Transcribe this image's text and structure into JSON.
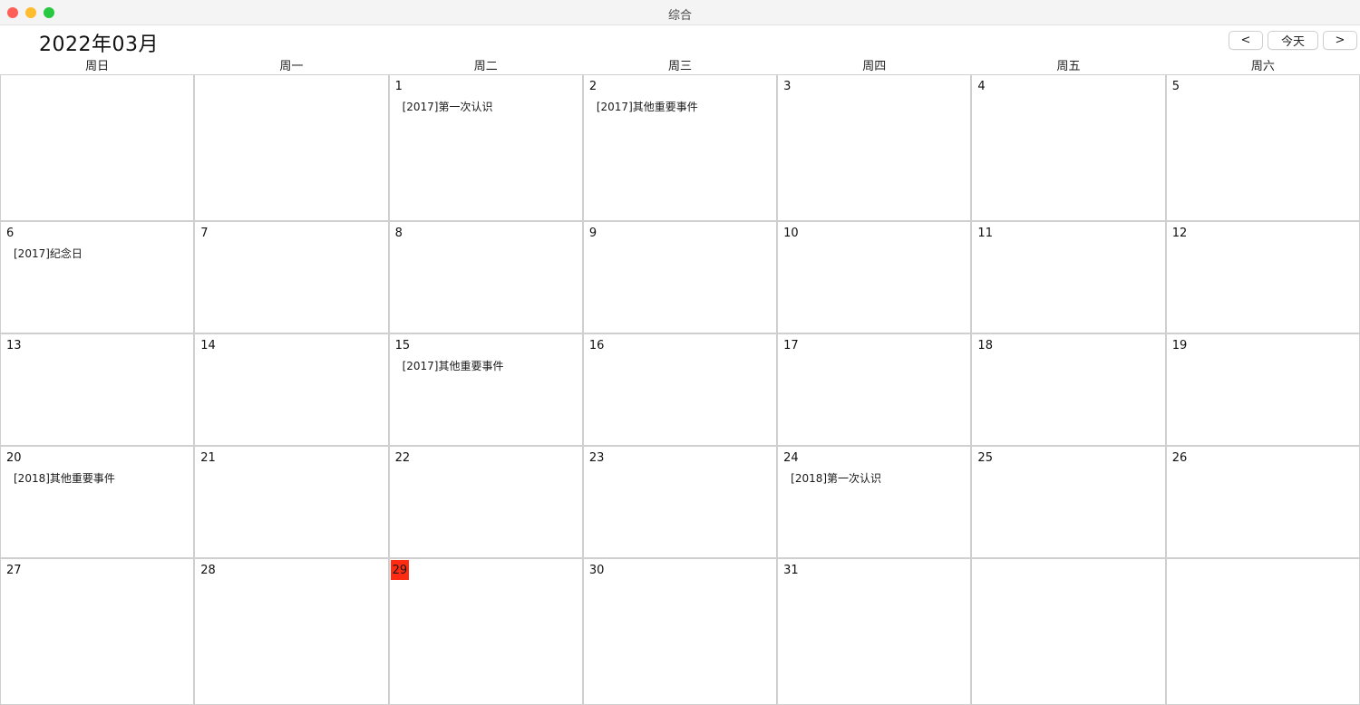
{
  "window": {
    "title": "综合"
  },
  "header": {
    "month_title": "2022年03月",
    "prev_label": "<",
    "today_label": "今天",
    "next_label": ">"
  },
  "weekdays": [
    "周日",
    "周一",
    "周二",
    "周三",
    "周四",
    "周五",
    "周六"
  ],
  "calendar": {
    "today": "29",
    "today_color": "#ff2b12",
    "weeks": [
      [
        {
          "day": "",
          "events": []
        },
        {
          "day": "",
          "events": []
        },
        {
          "day": "1",
          "events": [
            "[2017]第一次认识"
          ]
        },
        {
          "day": "2",
          "events": [
            "[2017]其他重要事件"
          ]
        },
        {
          "day": "3",
          "events": []
        },
        {
          "day": "4",
          "events": []
        },
        {
          "day": "5",
          "events": []
        }
      ],
      [
        {
          "day": "6",
          "events": [
            "[2017]纪念日"
          ]
        },
        {
          "day": "7",
          "events": []
        },
        {
          "day": "8",
          "events": []
        },
        {
          "day": "9",
          "events": []
        },
        {
          "day": "10",
          "events": []
        },
        {
          "day": "11",
          "events": []
        },
        {
          "day": "12",
          "events": []
        }
      ],
      [
        {
          "day": "13",
          "events": []
        },
        {
          "day": "14",
          "events": []
        },
        {
          "day": "15",
          "events": [
            "[2017]其他重要事件"
          ]
        },
        {
          "day": "16",
          "events": []
        },
        {
          "day": "17",
          "events": []
        },
        {
          "day": "18",
          "events": []
        },
        {
          "day": "19",
          "events": []
        }
      ],
      [
        {
          "day": "20",
          "events": [
            "[2018]其他重要事件"
          ]
        },
        {
          "day": "21",
          "events": []
        },
        {
          "day": "22",
          "events": []
        },
        {
          "day": "23",
          "events": []
        },
        {
          "day": "24",
          "events": [
            "[2018]第一次认识"
          ]
        },
        {
          "day": "25",
          "events": []
        },
        {
          "day": "26",
          "events": []
        }
      ],
      [
        {
          "day": "27",
          "events": []
        },
        {
          "day": "28",
          "events": []
        },
        {
          "day": "29",
          "events": []
        },
        {
          "day": "30",
          "events": []
        },
        {
          "day": "31",
          "events": []
        },
        {
          "day": "",
          "events": []
        },
        {
          "day": "",
          "events": []
        }
      ]
    ]
  }
}
